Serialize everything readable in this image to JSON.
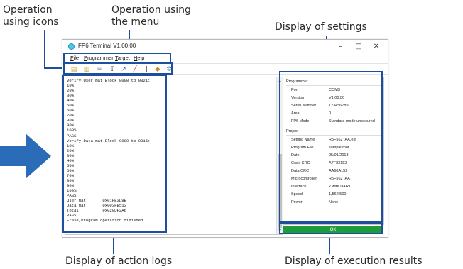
{
  "annotations": {
    "icons": [
      "Operation",
      "using icons"
    ],
    "menu": [
      "Operation using",
      "the menu"
    ],
    "settings": "Display of settings",
    "logs": "Display of action logs",
    "results": "Display of execution results"
  },
  "window": {
    "title": "FP6 Terminal V1.00.00",
    "controls": {
      "minimize": "–",
      "maximize": "□",
      "close": "✕"
    }
  },
  "menu": {
    "items": [
      {
        "accel": "F",
        "rest": "ile"
      },
      {
        "accel": "P",
        "rest": "rogrammer"
      },
      {
        "accel": "T",
        "rest": "arget"
      },
      {
        "accel": "H",
        "rest": "elp"
      }
    ]
  },
  "toolbar": {
    "icons": [
      "new-file-icon",
      "open-file-icon",
      "separator-icon",
      "connect-icon",
      "program-icon",
      "erase-icon",
      "info-icon",
      "lock-icon",
      "settings-icon"
    ]
  },
  "log": {
    "lines": [
      "Verify User mat Block 0000 to 0021:",
      "10%",
      "20%",
      "30%",
      "40%",
      "50%",
      "60%",
      "70%",
      "80%",
      "90%",
      "100%",
      "PASS",
      "Verify Data mat Block 0000 to 0015:",
      "10%",
      "20%",
      "30%",
      "40%",
      "50%",
      "60%",
      "70%",
      "80%",
      "90%",
      "100%",
      "PASS",
      "User mat:      0x01FE3D9E",
      "Data mat:      0x003FB513",
      "Total:         0x029DF2A6",
      "PASS",
      "Erase,Program operation finished."
    ]
  },
  "settings": {
    "programmer_title": "Programmer",
    "programmer": [
      {
        "label": "Port",
        "value": "COM3"
      },
      {
        "label": "Version",
        "value": "V1.00.00"
      },
      {
        "label": "Serial Number",
        "value": "123456789"
      },
      {
        "label": "Area",
        "value": "0"
      },
      {
        "label": "FP6 Mode",
        "value": "Standard mode unsecured"
      }
    ],
    "project_title": "Project",
    "project": [
      {
        "label": "Setting Name",
        "value": "R5F562TAA.esf"
      },
      {
        "label": "Program File",
        "value": "sample.mot"
      },
      {
        "label": "Date",
        "value": "05/01/2018"
      },
      {
        "label": "Code CRC",
        "value": "A7F831E3"
      },
      {
        "label": "Data CRC",
        "value": "AA60A152"
      },
      {
        "label": "Microcontroller",
        "value": "R5F562TAA"
      },
      {
        "label": "Interface",
        "value": "2 wire UART"
      },
      {
        "label": "Speed",
        "value": "1,562,500"
      },
      {
        "label": "Power",
        "value": "None"
      }
    ]
  },
  "result": {
    "text": "OK",
    "color": "#1e9b3a"
  },
  "colors": {
    "highlight": "#1f4e9c",
    "arrow": "#2b6cb8"
  }
}
